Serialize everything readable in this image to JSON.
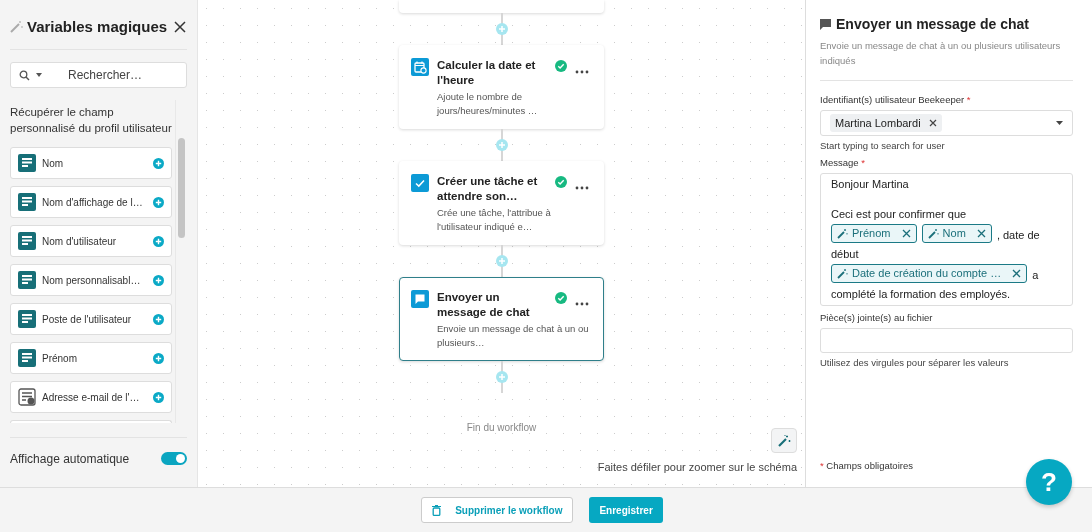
{
  "variables_panel": {
    "title": "Variables magiques",
    "search": {
      "placeholder": "Rechercher…"
    },
    "section_title": "Récupérer le champ personnalisé du profil utilisateur",
    "items": [
      {
        "label": "Nom",
        "kind": "text"
      },
      {
        "label": "Nom d'affichage de l…",
        "kind": "text"
      },
      {
        "label": "Nom d'utilisateur",
        "kind": "text"
      },
      {
        "label": "Nom personnalisabl…",
        "kind": "text"
      },
      {
        "label": "Poste de l'utilisateur",
        "kind": "text"
      },
      {
        "label": "Prénom",
        "kind": "text"
      },
      {
        "label": "Adresse e-mail de l'…",
        "kind": "email"
      }
    ],
    "auto_display": {
      "label": "Affichage automatique",
      "on": true
    }
  },
  "workflow": {
    "steps": [
      {
        "kind": "calendar",
        "title": "Calculer la date et l'heure",
        "description": "Ajoute le nombre de jours/heures/minutes …",
        "done": true,
        "selected": false
      },
      {
        "kind": "task",
        "title": "Créer une tâche et attendre son…",
        "description": "Crée une tâche, l'attribue à l'utilisateur indiqué e…",
        "done": true,
        "selected": false
      },
      {
        "kind": "chat",
        "title": "Envoyer un message de chat",
        "description": "Envoie un message de chat à un ou plusieurs…",
        "done": true,
        "selected": true
      }
    ],
    "end_label": "Fin du workflow",
    "zoom_hint": "Faites défiler pour zoomer sur le schéma"
  },
  "details": {
    "title": "Envoyer un message de chat",
    "description": "Envoie un message de chat à un ou plusieurs utilisateurs indiqués",
    "user_field": {
      "label": "Identifiant(s) utilisateur Beekeeper",
      "required": true,
      "value": "Martina Lombardi",
      "hint": "Start typing to search for user"
    },
    "message_field": {
      "label": "Message",
      "required": true,
      "parts": [
        {
          "kind": "text",
          "text": "Bonjour Martina"
        },
        {
          "kind": "break"
        },
        {
          "kind": "text",
          "text": "Ceci est pour confirmer que"
        },
        {
          "kind": "chip",
          "text": "Prénom"
        },
        {
          "kind": "chip",
          "text": "Nom"
        },
        {
          "kind": "text",
          "text": ", date de"
        },
        {
          "kind": "text",
          "text": "début"
        },
        {
          "kind": "chip",
          "text": "Date de création du compte …"
        },
        {
          "kind": "text",
          "text": "a"
        },
        {
          "kind": "text",
          "text": "complété la formation des employés."
        }
      ]
    },
    "attachment_field": {
      "label": "Pièce(s) jointe(s) au fichier",
      "hint": "Utilisez des virgules pour séparer les valeurs"
    },
    "required_marker": "*",
    "required_note": "Champs obligatoires"
  },
  "footer": {
    "delete_button": "Supprimer le workflow",
    "save_button": "Enregistrer",
    "help_button": "?"
  }
}
